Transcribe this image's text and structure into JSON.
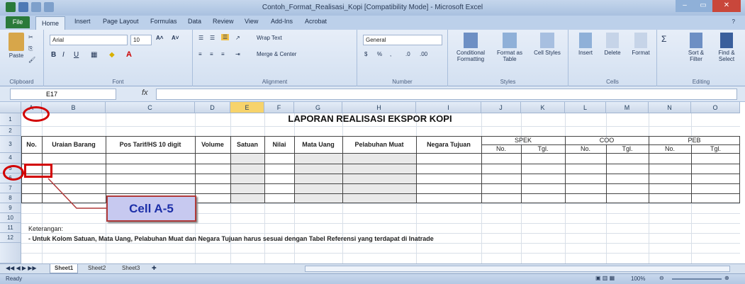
{
  "window": {
    "title": "Contoh_Format_Realisasi_Kopi [Compatibility Mode] - Microsoft Excel"
  },
  "ribbon_tabs": [
    "File",
    "Home",
    "Insert",
    "Page Layout",
    "Formulas",
    "Data",
    "Review",
    "View",
    "Add-Ins",
    "Acrobat"
  ],
  "ribbon": {
    "paste": "Paste",
    "clipboard": "Clipboard",
    "font_name": "Arial",
    "font_size": "10",
    "font_group": "Font",
    "wrap_text": "Wrap Text",
    "merge_center": "Merge & Center",
    "alignment_group": "Alignment",
    "number_format": "General",
    "number_group": "Number",
    "conditional_formatting": "Conditional Formatting",
    "format_as_table": "Format as Table",
    "cell_styles": "Cell Styles",
    "styles_group": "Styles",
    "insert": "Insert",
    "delete": "Delete",
    "format": "Format",
    "cells_group": "Cells",
    "sort_filter": "Sort & Filter",
    "find_select": "Find & Select",
    "editing_group": "Editing"
  },
  "formula_bar": {
    "name_box": "E17",
    "fx": "fx",
    "value": ""
  },
  "columns": [
    "A",
    "B",
    "C",
    "D",
    "E",
    "F",
    "G",
    "H",
    "I",
    "J",
    "K",
    "L",
    "M",
    "N",
    "O"
  ],
  "rows": [
    "1",
    "2",
    "3",
    "4",
    "5",
    "6",
    "7",
    "8",
    "9",
    "10",
    "11",
    "12"
  ],
  "sheet": {
    "title": "LAPORAN REALISASI EKSPOR KOPI",
    "headers": {
      "no": "No.",
      "uraian": "Uraian Barang",
      "pos_tarif": "Pos Tarif/HS 10 digit",
      "volume": "Volume",
      "satuan": "Satuan",
      "nilai": "Nilai",
      "mata_uang": "Mata Uang",
      "pelabuhan": "Pelabuhan Muat",
      "negara": "Negara Tujuan",
      "spek": "SPEK",
      "coo": "COO",
      "peb": "PEB",
      "sub_no": "No.",
      "sub_tgl": "Tgl."
    },
    "keterangan": "Keterangan:",
    "note": "- Untuk Kolom Satuan, Mata Uang, Pelabuhan Muat dan Negara Tujuan harus sesuai dengan Tabel Referensi yang terdapat di Inatrade"
  },
  "callout": "Cell A-5",
  "sheet_tabs": [
    "Sheet1",
    "Sheet2",
    "Sheet3"
  ],
  "status": {
    "ready": "Ready",
    "zoom": "100%"
  },
  "colors": {
    "highlight_red": "#d20000",
    "callout_bg": "#c7c9f0",
    "callout_text": "#1c2fa8",
    "selected_col": "#f7d36b",
    "file_tab": "#2a7a3a"
  }
}
